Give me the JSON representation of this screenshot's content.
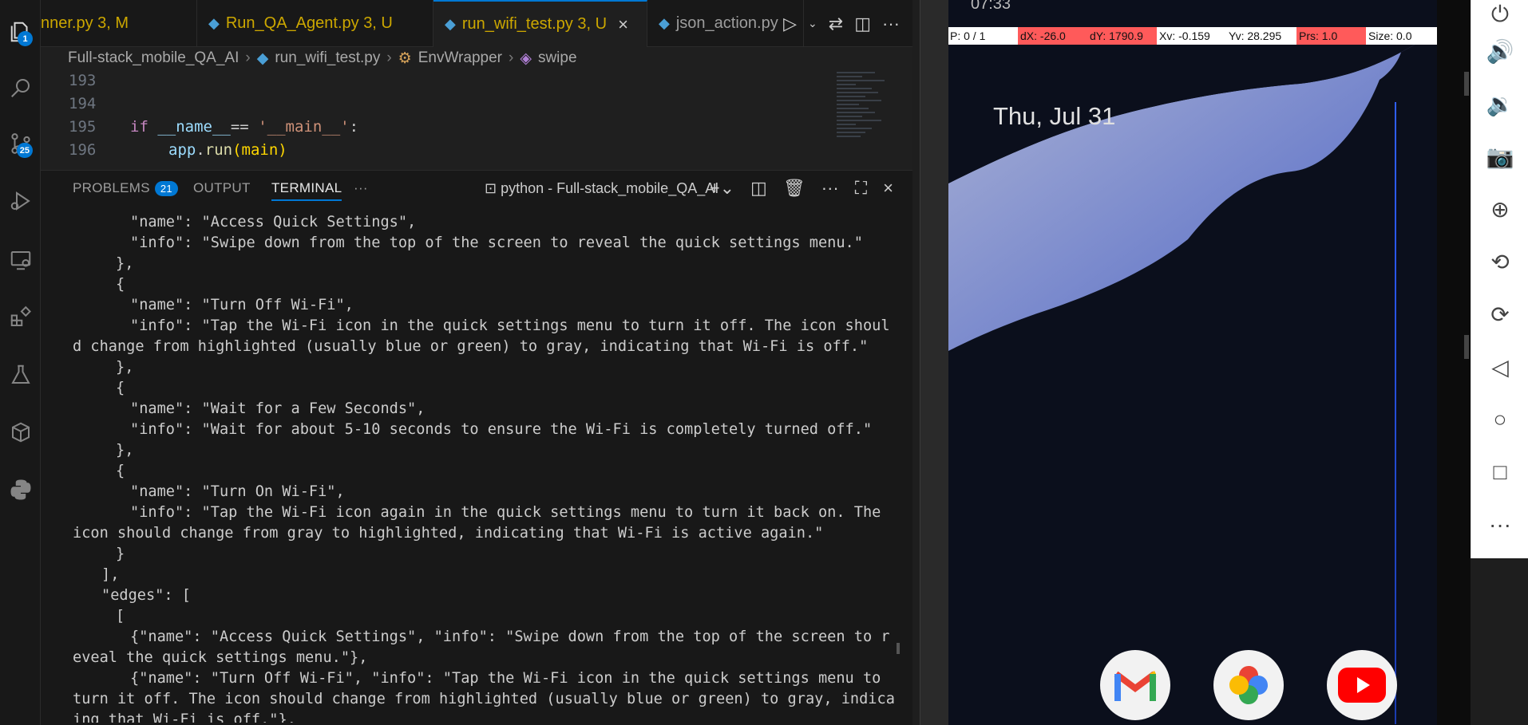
{
  "tabs": [
    {
      "label": "nner.py",
      "status": "3, M"
    },
    {
      "label": "Run_QA_Agent.py",
      "status": "3, U"
    },
    {
      "label": "run_wifi_test.py",
      "status": "3, U"
    },
    {
      "label": "json_action.py",
      "status": ""
    }
  ],
  "breadcrumb": [
    "Full-stack_mobile_QA_AI",
    "run_wifi_test.py",
    "EnvWrapper",
    "swipe"
  ],
  "activity_badges": {
    "explorer": "1",
    "source_control": "25"
  },
  "editor": {
    "line_numbers": [
      "193",
      "194",
      "195",
      "196"
    ],
    "line195": {
      "kw": "if",
      "var": "__name__",
      "op": " == ",
      "str": "'__main__'",
      "colon": ":"
    },
    "line196": {
      "obj": "app",
      "dot": ".",
      "fn": "run",
      "args": "(main)"
    }
  },
  "panel": {
    "tabs": {
      "problems": "PROBLEMS",
      "output": "OUTPUT",
      "terminal": "TERMINAL",
      "more": "···"
    },
    "problems_count": "21",
    "terminal_name": "python - Full-stack_mobile_QA_AI"
  },
  "terminal_lines": [
    "    \"name\": \"Access Quick Settings\",",
    "    \"info\": \"Swipe down from the top of the screen to reveal the quick settings menu.\"",
    "  },",
    "  {",
    "    \"name\": \"Turn Off Wi-Fi\",",
    "    \"info\": \"Tap the Wi-Fi icon in the quick settings menu to turn it off. The icon shoul",
    "d change from highlighted (usually blue or green) to gray, indicating that Wi-Fi is off.\"",
    "  },",
    "  {",
    "    \"name\": \"Wait for a Few Seconds\",",
    "    \"info\": \"Wait for about 5-10 seconds to ensure the Wi-Fi is completely turned off.\"",
    "  },",
    "  {",
    "    \"name\": \"Turn On Wi-Fi\",",
    "    \"info\": \"Tap the Wi-Fi icon again in the quick settings menu to turn it back on. The",
    "icon should change from gray to highlighted, indicating that Wi-Fi is active again.\"",
    "  }",
    "],",
    "\"edges\": [",
    "  [",
    "    {\"name\": \"Access Quick Settings\", \"info\": \"Swipe down from the top of the screen to r",
    "eveal the quick settings menu.\"},",
    "    {\"name\": \"Turn Off Wi-Fi\", \"info\": \"Tap the Wi-Fi icon in the quick settings menu to",
    "turn it off. The icon should change from highlighted (usually blue or green) to gray, indicat",
    "ing that Wi-Fi is off.\"},"
  ],
  "phone": {
    "clock": "07:33",
    "date": "Thu, Jul 31",
    "pointer_overlay": {
      "p": "P: 0 / 1",
      "dx": "dX: -26.0",
      "dy": "dY: 1790.9",
      "xv": "Xv: -0.159",
      "yv": "Yv: 28.295",
      "prs": "Prs: 1.0",
      "size": "Size: 0.0"
    },
    "dock_apps": [
      "gmail-icon",
      "photos-icon",
      "youtube-icon"
    ]
  },
  "colors": {
    "accent": "#0078d4",
    "overlay_red": "#ff5a5a",
    "modified": "#cca700"
  }
}
